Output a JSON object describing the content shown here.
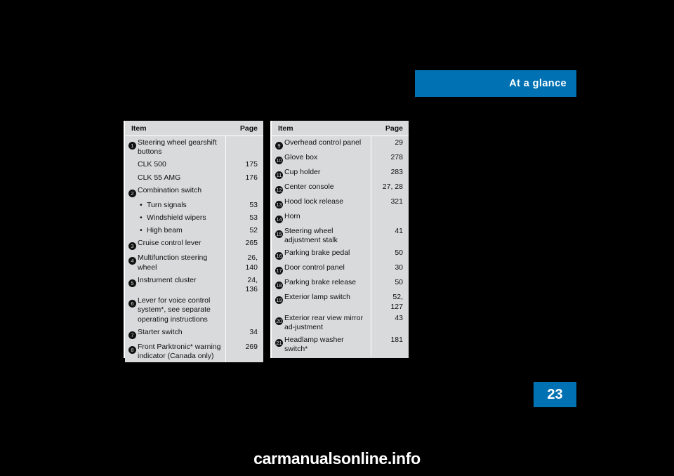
{
  "header": {
    "title": "At a glance"
  },
  "page_number": "23",
  "footer": {
    "watermark": "carmanualsonline.info"
  },
  "tables": [
    {
      "id": "left",
      "columns": [
        "Item",
        "Page"
      ],
      "rows": [
        {
          "num": "1",
          "text": "Steering wheel gearshift buttons",
          "page": ""
        },
        {
          "num": "",
          "text": "CLK 500",
          "page": "175"
        },
        {
          "num": "",
          "text": "CLK 55 AMG",
          "page": "176"
        },
        {
          "num": "2",
          "text": "Combination switch",
          "page": ""
        },
        {
          "num": "",
          "bullet": true,
          "text": "Turn signals",
          "page": "53"
        },
        {
          "num": "",
          "bullet": true,
          "text": "Windshield wipers",
          "page": "53"
        },
        {
          "num": "",
          "bullet": true,
          "text": "High beam",
          "page": "52"
        },
        {
          "num": "3",
          "text": "Cruise control lever",
          "page": "265"
        },
        {
          "num": "4",
          "text": "Multifunction steering wheel",
          "page": "26, 140"
        },
        {
          "num": "5",
          "text": "Instrument cluster",
          "page": "24, 136"
        },
        {
          "num": "6",
          "text": "Lever for voice control system*, see separate operating instructions",
          "page": ""
        },
        {
          "num": "7",
          "text": "Starter switch",
          "page": "34"
        },
        {
          "num": "8",
          "text": "Front Parktronic* warning indicator (Canada only)",
          "page": "269"
        }
      ]
    },
    {
      "id": "right",
      "columns": [
        "Item",
        "Page"
      ],
      "rows": [
        {
          "num": "9",
          "text": "Overhead control panel",
          "page": "29"
        },
        {
          "num": "10",
          "text": "Glove box",
          "page": "278"
        },
        {
          "num": "11",
          "text": "Cup holder",
          "page": "283"
        },
        {
          "num": "12",
          "text": "Center console",
          "page": "27, 28"
        },
        {
          "num": "13",
          "text": "Hood lock release",
          "page": "321"
        },
        {
          "num": "14",
          "text": "Horn",
          "page": ""
        },
        {
          "num": "15",
          "text": "Steering wheel adjustment stalk",
          "page": "41"
        },
        {
          "num": "16",
          "text": "Parking brake pedal",
          "page": "50"
        },
        {
          "num": "17",
          "text": "Door control panel",
          "page": "30"
        },
        {
          "num": "18",
          "text": "Parking brake release",
          "page": "50"
        },
        {
          "num": "19",
          "text": "Exterior lamp switch",
          "page": "52, 127"
        },
        {
          "num": "20",
          "text": "Exterior rear view mirror ad-justment",
          "page": "43"
        },
        {
          "num": "21",
          "text": "Headlamp washer switch*",
          "page": "181"
        }
      ]
    }
  ],
  "colors": {
    "accent": "#0071b3",
    "table_bg": "#d9dadb",
    "page_bg": "#000000"
  }
}
